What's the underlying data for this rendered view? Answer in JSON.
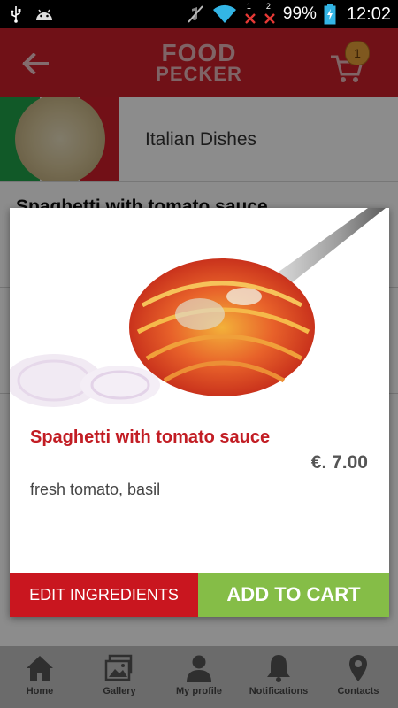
{
  "status_bar": {
    "battery_pct": "99%",
    "time": "12:02",
    "icons": [
      "usb-icon",
      "android-icon",
      "mute-icon",
      "wifi-icon",
      "sim1-no-signal-icon",
      "sim2-no-signal-icon",
      "battery-charging-icon"
    ],
    "sim1_label": "1",
    "sim2_label": "2"
  },
  "header": {
    "logo_line1": "FOOD",
    "logo_line2": "PECKER",
    "cart_count": "1",
    "brand_color": "#cc1f2a"
  },
  "category": {
    "label": "Italian Dishes"
  },
  "list": {
    "item_title": "Spaghetti with tomato sauce"
  },
  "dialog": {
    "title": "Spaghetti with tomato sauce",
    "price": "€. 7.00",
    "description": "fresh tomato, basil",
    "edit_label": "EDIT INGREDIENTS",
    "add_label": "ADD TO CART",
    "edit_color": "#c9161f",
    "add_color": "#85bd47"
  },
  "bottom_nav": {
    "items": [
      {
        "label": "Home",
        "icon": "home-icon"
      },
      {
        "label": "Gallery",
        "icon": "gallery-icon"
      },
      {
        "label": "My profile",
        "icon": "profile-icon"
      },
      {
        "label": "Notifications",
        "icon": "bell-icon"
      },
      {
        "label": "Contacts",
        "icon": "map-pin-icon"
      }
    ]
  }
}
